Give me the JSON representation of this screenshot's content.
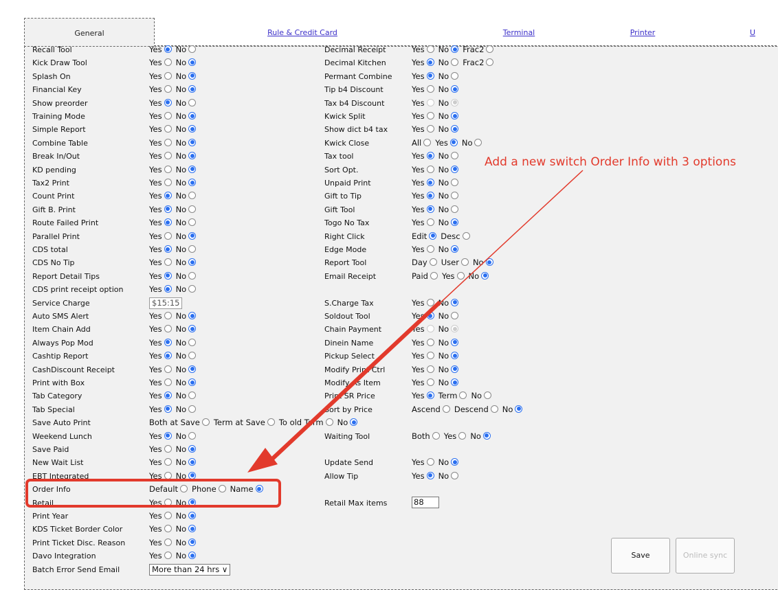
{
  "tabs": [
    {
      "label": "General",
      "active": true
    },
    {
      "label": "Rule & Credit Card",
      "active": false
    },
    {
      "label": "Terminal",
      "active": false
    },
    {
      "label": "Printer",
      "active": false
    },
    {
      "label": "U",
      "active": false
    }
  ],
  "left": [
    {
      "label": "Recall Tool",
      "options": [
        {
          "t": "Yes",
          "on": true
        },
        {
          "t": "No",
          "on": false
        }
      ]
    },
    {
      "label": "Kick Draw Tool",
      "options": [
        {
          "t": "Yes",
          "on": false
        },
        {
          "t": "No",
          "on": true
        }
      ]
    },
    {
      "label": "Splash On",
      "options": [
        {
          "t": "Yes",
          "on": false
        },
        {
          "t": "No",
          "on": true
        }
      ]
    },
    {
      "label": "Financial Key",
      "options": [
        {
          "t": "Yes",
          "on": false
        },
        {
          "t": "No",
          "on": true
        }
      ]
    },
    {
      "label": "Show preorder",
      "options": [
        {
          "t": "Yes",
          "on": true
        },
        {
          "t": "No",
          "on": false
        }
      ]
    },
    {
      "label": "Training Mode",
      "options": [
        {
          "t": "Yes",
          "on": false
        },
        {
          "t": "No",
          "on": true
        }
      ]
    },
    {
      "label": "Simple Report",
      "options": [
        {
          "t": "Yes",
          "on": false
        },
        {
          "t": "No",
          "on": true
        }
      ]
    },
    {
      "label": "Combine Table",
      "options": [
        {
          "t": "Yes",
          "on": false
        },
        {
          "t": "No",
          "on": true
        }
      ]
    },
    {
      "label": "Break In/Out",
      "options": [
        {
          "t": "Yes",
          "on": false
        },
        {
          "t": "No",
          "on": true
        }
      ]
    },
    {
      "label": "KD pending",
      "options": [
        {
          "t": "Yes",
          "on": false
        },
        {
          "t": "No",
          "on": true
        }
      ]
    },
    {
      "label": "Tax2 Print",
      "options": [
        {
          "t": "Yes",
          "on": false
        },
        {
          "t": "No",
          "on": true
        }
      ]
    },
    {
      "label": "Count Print",
      "options": [
        {
          "t": "Yes",
          "on": true
        },
        {
          "t": "No",
          "on": false
        }
      ]
    },
    {
      "label": "Gift B. Print",
      "options": [
        {
          "t": "Yes",
          "on": true
        },
        {
          "t": "No",
          "on": false
        }
      ]
    },
    {
      "label": "Route Failed Print",
      "options": [
        {
          "t": "Yes",
          "on": true
        },
        {
          "t": "No",
          "on": false
        }
      ]
    },
    {
      "label": "Parallel Print",
      "options": [
        {
          "t": "Yes",
          "on": false
        },
        {
          "t": "No",
          "on": true
        }
      ]
    },
    {
      "label": "CDS total",
      "options": [
        {
          "t": "Yes",
          "on": true
        },
        {
          "t": "No",
          "on": false
        }
      ]
    },
    {
      "label": "CDS No Tip",
      "options": [
        {
          "t": "Yes",
          "on": false
        },
        {
          "t": "No",
          "on": true
        }
      ]
    },
    {
      "label": "Report Detail Tips",
      "options": [
        {
          "t": "Yes",
          "on": true
        },
        {
          "t": "No",
          "on": false
        }
      ]
    },
    {
      "label": "CDS print receipt option",
      "options": [
        {
          "t": "Yes",
          "on": true
        },
        {
          "t": "No",
          "on": false
        }
      ]
    },
    {
      "label": "Service Charge",
      "text": "$15:15"
    },
    {
      "label": "Auto SMS Alert",
      "options": [
        {
          "t": "Yes",
          "on": false
        },
        {
          "t": "No",
          "on": true
        }
      ]
    },
    {
      "label": "Item Chain Add",
      "options": [
        {
          "t": "Yes",
          "on": false
        },
        {
          "t": "No",
          "on": true
        }
      ]
    },
    {
      "label": "Always Pop Mod",
      "options": [
        {
          "t": "Yes",
          "on": true
        },
        {
          "t": "No",
          "on": false
        }
      ]
    },
    {
      "label": "Cashtip Report",
      "options": [
        {
          "t": "Yes",
          "on": true
        },
        {
          "t": "No",
          "on": false
        }
      ]
    },
    {
      "label": "CashDiscount Receipt",
      "options": [
        {
          "t": "Yes",
          "on": false
        },
        {
          "t": "No",
          "on": true
        }
      ]
    },
    {
      "label": "Print with Box",
      "options": [
        {
          "t": "Yes",
          "on": false
        },
        {
          "t": "No",
          "on": true
        }
      ]
    },
    {
      "label": "Tab Category",
      "options": [
        {
          "t": "Yes",
          "on": true
        },
        {
          "t": "No",
          "on": false
        }
      ]
    },
    {
      "label": "Tab Special",
      "options": [
        {
          "t": "Yes",
          "on": true
        },
        {
          "t": "No",
          "on": false
        }
      ]
    },
    {
      "label": "Save Auto Print",
      "options": [
        {
          "t": "Both at Save",
          "on": false
        },
        {
          "t": "Term at Save",
          "on": false
        },
        {
          "t": "To old Term",
          "on": false
        },
        {
          "t": "No",
          "on": true
        }
      ]
    },
    {
      "label": "Weekend Lunch",
      "options": [
        {
          "t": "Yes",
          "on": true
        },
        {
          "t": "No",
          "on": false
        }
      ]
    },
    {
      "label": "Save Paid",
      "options": [
        {
          "t": "Yes",
          "on": false
        },
        {
          "t": "No",
          "on": true
        }
      ]
    },
    {
      "label": "New Wait List",
      "options": [
        {
          "t": "Yes",
          "on": false
        },
        {
          "t": "No",
          "on": true
        }
      ]
    },
    {
      "label": "EBT Integrated",
      "options": [
        {
          "t": "Yes",
          "on": false
        },
        {
          "t": "No",
          "on": true
        }
      ]
    },
    {
      "label": "Order Info",
      "options": [
        {
          "t": "Default",
          "on": false
        },
        {
          "t": "Phone",
          "on": false
        },
        {
          "t": "Name",
          "on": true
        }
      ]
    },
    {
      "label": "Retail",
      "options": [
        {
          "t": "Yes",
          "on": false
        },
        {
          "t": "No",
          "on": true
        }
      ]
    },
    {
      "label": "Print Year",
      "options": [
        {
          "t": "Yes",
          "on": false
        },
        {
          "t": "No",
          "on": true
        }
      ]
    },
    {
      "label": "KDS Ticket Border Color",
      "options": [
        {
          "t": "Yes",
          "on": false
        },
        {
          "t": "No",
          "on": true
        }
      ]
    },
    {
      "label": "Print Ticket Disc. Reason",
      "options": [
        {
          "t": "Yes",
          "on": false
        },
        {
          "t": "No",
          "on": true
        }
      ]
    },
    {
      "label": "Davo Integration",
      "options": [
        {
          "t": "Yes",
          "on": false
        },
        {
          "t": "No",
          "on": true
        }
      ]
    },
    {
      "label": "Batch Error Send Email",
      "select": "More than 24 hrs"
    }
  ],
  "right": [
    {
      "label": "Decimal Receipt",
      "options": [
        {
          "t": "Yes",
          "on": false
        },
        {
          "t": "No",
          "on": true
        },
        {
          "t": "Frac2",
          "on": false
        }
      ]
    },
    {
      "label": "Decimal Kitchen",
      "options": [
        {
          "t": "Yes",
          "on": true
        },
        {
          "t": "No",
          "on": false
        },
        {
          "t": "Frac2",
          "on": false
        }
      ]
    },
    {
      "label": "Permant Combine",
      "options": [
        {
          "t": "Yes",
          "on": true
        },
        {
          "t": "No",
          "on": false
        }
      ]
    },
    {
      "label": "Tip b4 Discount",
      "options": [
        {
          "t": "Yes",
          "on": false
        },
        {
          "t": "No",
          "on": true
        }
      ]
    },
    {
      "label": "Tax b4 Discount",
      "options": [
        {
          "t": "Yes",
          "on": false,
          "dis": true
        },
        {
          "t": "No",
          "on": true,
          "dis": true
        }
      ]
    },
    {
      "label": "Kwick Split",
      "options": [
        {
          "t": "Yes",
          "on": false
        },
        {
          "t": "No",
          "on": true
        }
      ]
    },
    {
      "label": "Show dict b4 tax",
      "options": [
        {
          "t": "Yes",
          "on": false
        },
        {
          "t": "No",
          "on": true
        }
      ]
    },
    {
      "label": "Kwick Close",
      "options": [
        {
          "t": "All",
          "on": false
        },
        {
          "t": "Yes",
          "on": true
        },
        {
          "t": "No",
          "on": false
        }
      ]
    },
    {
      "label": "Tax tool",
      "options": [
        {
          "t": "Yes",
          "on": true
        },
        {
          "t": "No",
          "on": false
        }
      ]
    },
    {
      "label": "Sort Opt.",
      "options": [
        {
          "t": "Yes",
          "on": false
        },
        {
          "t": "No",
          "on": true
        }
      ]
    },
    {
      "label": "Unpaid Print",
      "options": [
        {
          "t": "Yes",
          "on": true
        },
        {
          "t": "No",
          "on": false
        }
      ]
    },
    {
      "label": "Gift to Tip",
      "options": [
        {
          "t": "Yes",
          "on": true
        },
        {
          "t": "No",
          "on": false
        }
      ]
    },
    {
      "label": "Gift Tool",
      "options": [
        {
          "t": "Yes",
          "on": true
        },
        {
          "t": "No",
          "on": false
        }
      ]
    },
    {
      "label": "Togo No Tax",
      "options": [
        {
          "t": "Yes",
          "on": false
        },
        {
          "t": "No",
          "on": true
        }
      ]
    },
    {
      "label": "Right Click",
      "options": [
        {
          "t": "Edit",
          "on": true
        },
        {
          "t": "Desc",
          "on": false
        }
      ]
    },
    {
      "label": "Edge Mode",
      "options": [
        {
          "t": "Yes",
          "on": false
        },
        {
          "t": "No",
          "on": true
        }
      ]
    },
    {
      "label": "Report Tool",
      "options": [
        {
          "t": "Day",
          "on": false
        },
        {
          "t": "User",
          "on": false
        },
        {
          "t": "No",
          "on": true
        }
      ]
    },
    {
      "label": "Email Receipt",
      "options": [
        {
          "t": "Paid",
          "on": false
        },
        {
          "t": "Yes",
          "on": false
        },
        {
          "t": "No",
          "on": true
        }
      ]
    },
    null,
    {
      "label": "S.Charge Tax",
      "options": [
        {
          "t": "Yes",
          "on": false
        },
        {
          "t": "No",
          "on": true
        }
      ]
    },
    {
      "label": "Soldout Tool",
      "options": [
        {
          "t": "Yes",
          "on": true
        },
        {
          "t": "No",
          "on": false
        }
      ]
    },
    {
      "label": "Chain Payment",
      "options": [
        {
          "t": "Yes",
          "on": false,
          "dis": true
        },
        {
          "t": "No",
          "on": true,
          "dis": true
        }
      ]
    },
    {
      "label": "Dinein Name",
      "options": [
        {
          "t": "Yes",
          "on": false
        },
        {
          "t": "No",
          "on": true
        }
      ]
    },
    {
      "label": "Pickup Select",
      "options": [
        {
          "t": "Yes",
          "on": false
        },
        {
          "t": "No",
          "on": true
        }
      ]
    },
    {
      "label": "Modify Print Ctrl",
      "options": [
        {
          "t": "Yes",
          "on": false
        },
        {
          "t": "No",
          "on": true
        }
      ]
    },
    {
      "label": "Modify As Item",
      "options": [
        {
          "t": "Yes",
          "on": false
        },
        {
          "t": "No",
          "on": true
        }
      ]
    },
    {
      "label": "Print SR Price",
      "options": [
        {
          "t": "Yes",
          "on": true
        },
        {
          "t": "Term",
          "on": false
        },
        {
          "t": "No",
          "on": false
        }
      ]
    },
    {
      "label": "Sort by Price",
      "options": [
        {
          "t": "Ascend",
          "on": false
        },
        {
          "t": "Descend",
          "on": false
        },
        {
          "t": "No",
          "on": true
        }
      ]
    },
    null,
    {
      "label": "Waiting Tool",
      "options": [
        {
          "t": "Both",
          "on": false
        },
        {
          "t": "Yes",
          "on": false
        },
        {
          "t": "No",
          "on": true
        }
      ]
    },
    null,
    {
      "label": "Update Send",
      "options": [
        {
          "t": "Yes",
          "on": false
        },
        {
          "t": "No",
          "on": true
        }
      ]
    },
    {
      "label": "Allow Tip",
      "options": [
        {
          "t": "Yes",
          "on": true
        },
        {
          "t": "No",
          "on": false
        }
      ]
    },
    null,
    {
      "label": "Retail Max items",
      "number": "88"
    }
  ],
  "buttons": {
    "save": "Save",
    "sync": "Online sync"
  },
  "annotation": {
    "text": "Add a new switch Order Info with 3 options",
    "color": "#e23a2c"
  },
  "colors": {
    "radio_on": "#2a6ff0",
    "link": "#3b2fc9",
    "panel": "#f1f1f1"
  }
}
